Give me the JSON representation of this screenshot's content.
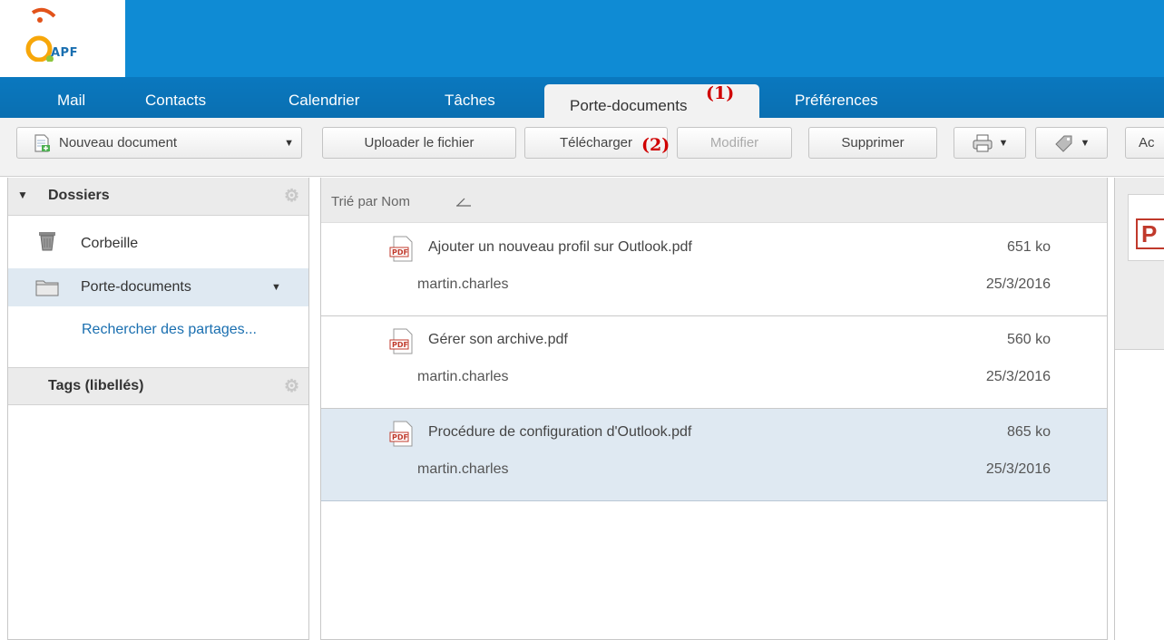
{
  "logo": {
    "text": "APF"
  },
  "tabs": [
    {
      "label": "Mail"
    },
    {
      "label": "Contacts"
    },
    {
      "label": "Calendrier"
    },
    {
      "label": "Tâches"
    },
    {
      "label": "Porte-documents",
      "active": true
    },
    {
      "label": "Préférences"
    }
  ],
  "annotations": {
    "tab_marker": "(1)",
    "download_marker": "(2)"
  },
  "toolbar": {
    "new_document": "Nouveau document",
    "upload": "Uploader le fichier",
    "download": "Télécharger",
    "modify": "Modifier",
    "delete": "Supprimer",
    "print_icon": "print-icon",
    "tag_icon": "tag-icon",
    "more": "Ac"
  },
  "sidebar": {
    "folders_header": "Dossiers",
    "items": [
      {
        "label": "Corbeille",
        "icon": "trash-icon"
      },
      {
        "label": "Porte-documents",
        "icon": "folder-icon",
        "selected": true
      }
    ],
    "search_shares": "Rechercher des partages...",
    "tags_header": "Tags (libellés)"
  },
  "list": {
    "sort_label": "Trié par Nom",
    "documents": [
      {
        "name": "Ajouter un nouveau profil sur Outlook.pdf",
        "owner": "martin.charles",
        "size": "651 ko",
        "date": "25/3/2016"
      },
      {
        "name": "Gérer son archive.pdf",
        "owner": "martin.charles",
        "size": "560 ko",
        "date": "25/3/2016"
      },
      {
        "name": "Procédure de configuration d'Outlook.pdf",
        "owner": "martin.charles",
        "size": "865 ko",
        "date": "25/3/2016",
        "selected": true
      }
    ]
  },
  "preview": {
    "letter": "P"
  },
  "colors": {
    "banner": "#0f8bd4",
    "tabbar": "#0a6fb1",
    "selection": "#dfe9f2",
    "annotation": "#d00000"
  }
}
